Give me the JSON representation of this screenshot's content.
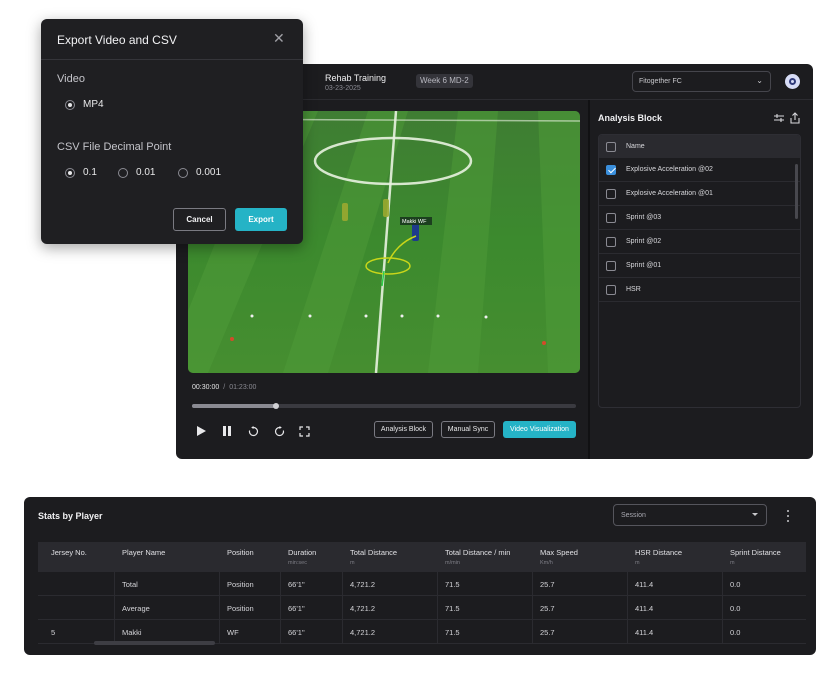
{
  "window": {
    "session_title": "Rehab Training",
    "session_date": "03-23-2025",
    "week_badge": "Week 6 MD-2",
    "team_select": "Fitogether FC"
  },
  "player": {
    "player_tag": "Makki WF",
    "current_time": "00:30:00",
    "time_separator": "/",
    "total_time": "01:23:00",
    "progress_fraction": 0.22,
    "btn_analysis_block": "Analysis Block",
    "btn_manual_sync": "Manual Sync",
    "btn_video_visualization": "Video Visualization"
  },
  "analysis_block": {
    "title": "Analysis Block",
    "header": "Name",
    "rows": [
      {
        "label": "Explosive Acceleration @02",
        "checked": true
      },
      {
        "label": "Explosive Acceleration @01",
        "checked": false
      },
      {
        "label": "Sprint @03",
        "checked": false
      },
      {
        "label": "Sprint @02",
        "checked": false
      },
      {
        "label": "Sprint @01",
        "checked": false
      },
      {
        "label": "HSR",
        "checked": false
      }
    ]
  },
  "export_dialog": {
    "title": "Export Video and CSV",
    "video_section": "Video",
    "video_option": "MP4",
    "csv_section": "CSV File Decimal Point",
    "decimal_options": [
      "0.1",
      "0.01",
      "0.001"
    ],
    "decimal_selected": "0.1",
    "cancel": "Cancel",
    "export": "Export"
  },
  "stats": {
    "title": "Stats by Player",
    "session_placeholder": "Session",
    "columns": [
      {
        "label": "Jersey No.",
        "unit": ""
      },
      {
        "label": "Player Name",
        "unit": ""
      },
      {
        "label": "Position",
        "unit": ""
      },
      {
        "label": "Duration",
        "unit": "min:sec"
      },
      {
        "label": "Total Distance",
        "unit": "m"
      },
      {
        "label": "Total Distance / min",
        "unit": "m/min"
      },
      {
        "label": "Max Speed",
        "unit": "Km/h"
      },
      {
        "label": "HSR Distance",
        "unit": "m"
      },
      {
        "label": "Sprint Distance",
        "unit": "m"
      }
    ],
    "rows": [
      [
        "",
        "Total",
        "Position",
        "66'1\"",
        "4,721.2",
        "71.5",
        "25.7",
        "411.4",
        "0.0"
      ],
      [
        "",
        "Average",
        "Position",
        "66'1\"",
        "4,721.2",
        "71.5",
        "25.7",
        "411.4",
        "0.0"
      ],
      [
        "5",
        "Makki",
        "WF",
        "66'1\"",
        "4,721.2",
        "71.5",
        "25.7",
        "411.4",
        "0.0"
      ]
    ]
  },
  "colors": {
    "accent": "#25b3c6",
    "panel_bg": "#1c1c1f",
    "check": "#3a8fdc"
  }
}
